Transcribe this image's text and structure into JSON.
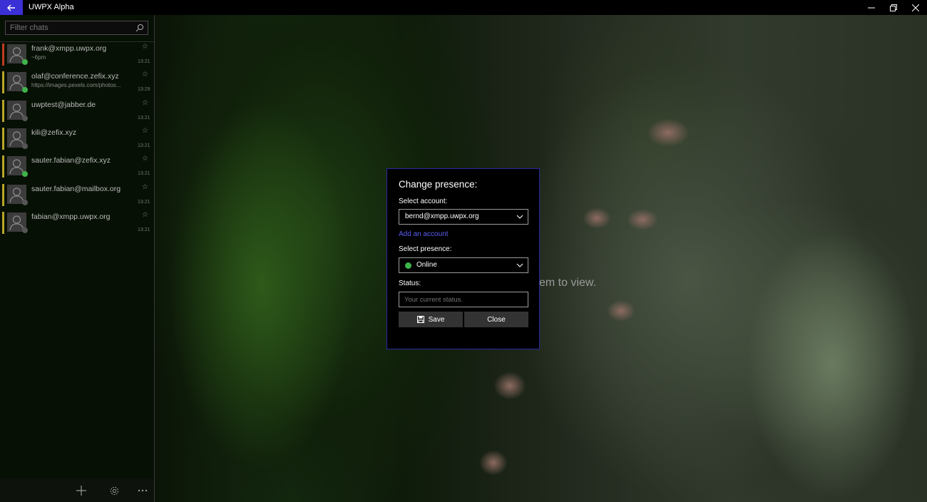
{
  "window": {
    "title": "UWPX Alpha",
    "back_icon": "back-arrow-icon",
    "accent_color": "#3b2fd6"
  },
  "sidebar": {
    "filter_placeholder": "Filter chats",
    "chats": [
      {
        "name": "frank@xmpp.uwpx.org",
        "subtitle": "~6pm",
        "time": "13:21",
        "bar_color": "#c23b22",
        "presence_color": "#3fb24a"
      },
      {
        "name": "olaf@conference.zefix.xyz",
        "subtitle": "https://images.pexels.com/photos...",
        "time": "13:29",
        "bar_color": "#b9a52a",
        "presence_color": "#3fb24a"
      },
      {
        "name": "uwptest@jabber.de",
        "subtitle": "",
        "time": "13:21",
        "bar_color": "#b9a52a",
        "presence_color": "#555555"
      },
      {
        "name": "kili@zefix.xyz",
        "subtitle": "",
        "time": "13:21",
        "bar_color": "#b9a52a",
        "presence_color": "#555555"
      },
      {
        "name": "sauter.fabian@zefix.xyz",
        "subtitle": "",
        "time": "13:21",
        "bar_color": "#b9a52a",
        "presence_color": "#3fb24a"
      },
      {
        "name": "sauter.fabian@mailbox.org",
        "subtitle": "",
        "time": "13:21",
        "bar_color": "#b9a52a",
        "presence_color": "#555555"
      },
      {
        "name": "fabian@xmpp.uwpx.org",
        "subtitle": "",
        "time": "13:21",
        "bar_color": "#b9a52a",
        "presence_color": "#555555"
      }
    ],
    "star_glyph": "☆"
  },
  "background": {
    "hint_text": "em to view."
  },
  "dialog": {
    "title": "Change presence:",
    "account_label": "Select account:",
    "account_value": "bernd@xmpp.uwpx.org",
    "add_account_link": "Add an account",
    "presence_label": "Select presence:",
    "presence_value": "Online",
    "status_label": "Status:",
    "status_placeholder": "Your current status.",
    "save_label": "Save",
    "close_label": "Close"
  }
}
